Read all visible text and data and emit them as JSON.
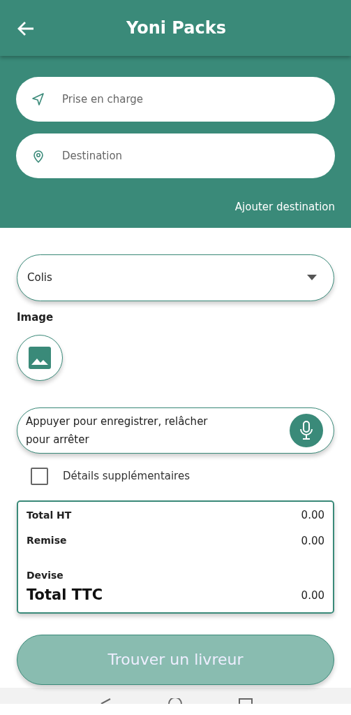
{
  "app_bar": {
    "title": "Yoni Packs"
  },
  "route": {
    "fields": [
      {
        "kind": "pickup",
        "placeholder": "Prise en charge"
      },
      {
        "kind": "destination",
        "placeholder": "Destination"
      }
    ],
    "add_link": "Ajouter destination"
  },
  "package_type": {
    "value": "Colis"
  },
  "image_label": "Image",
  "voice_field": {
    "placeholder": "Appuyer pour enregistrer, relâcher pour arrêter"
  },
  "extra_details": {
    "label": "Détails supplémentaires",
    "checked": false
  },
  "summary": {
    "rows": [
      {
        "kind": "line",
        "label": "Total HT",
        "value": "0.00"
      },
      {
        "kind": "line",
        "label": "Remise",
        "value": "0.00"
      },
      {
        "kind": "caption",
        "label": "Devise"
      },
      {
        "kind": "total",
        "label": "Total TTC",
        "value": "0.00"
      }
    ]
  },
  "submit_button": {
    "label": "Trouver un livreur",
    "disabled": true
  }
}
